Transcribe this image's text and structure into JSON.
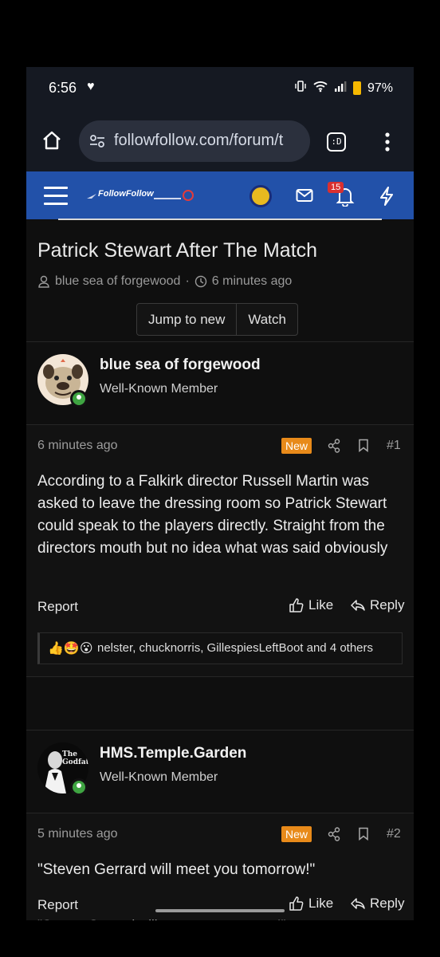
{
  "status_bar": {
    "time": "6:56",
    "battery": "97%"
  },
  "browser": {
    "url": "followfollow.com/forum/t",
    "tab_icon_text": ":D"
  },
  "site": {
    "logo_text": "FollowFollow",
    "notification_count": "15"
  },
  "thread": {
    "title": "Patrick Stewart After The Match",
    "author": "blue sea of forgewood",
    "age": "6 minutes ago",
    "meta_separator": "·",
    "jump_label": "Jump to new",
    "watch_label": "Watch"
  },
  "posts": [
    {
      "username": "blue sea of forgewood",
      "user_title": "Well-Known Member",
      "time": "6 minutes ago",
      "new_label": "New",
      "number": "#1",
      "body": "According to a Falkirk director Russell Martin was asked to leave the dressing room so Patrick Stewart could speak to the players directly. Straight from the directors mouth but no idea what was said obviously",
      "report_label": "Report",
      "like_label": "Like",
      "reply_label": "Reply",
      "reaction_emojis": "👍🤩😮",
      "reaction_names": "nelster, chucknorris, GillespiesLeftBoot and 4 others"
    },
    {
      "username": "HMS.Temple.Garden",
      "user_title": "Well-Known Member",
      "avatar_text": "The Godfather",
      "time": "5 minutes ago",
      "new_label": "New",
      "number": "#2",
      "body": "\"Steven Gerrard will meet you tomorrow!\"",
      "report_label": "Report",
      "like_label": "Like",
      "reply_label": "Reply",
      "cut_text": "\"Steven Gerrard will meet you tomorrow!\""
    }
  ],
  "colors": {
    "header_blue": "#2251a9",
    "new_badge": "#e88a1a",
    "online": "#3fa542"
  }
}
